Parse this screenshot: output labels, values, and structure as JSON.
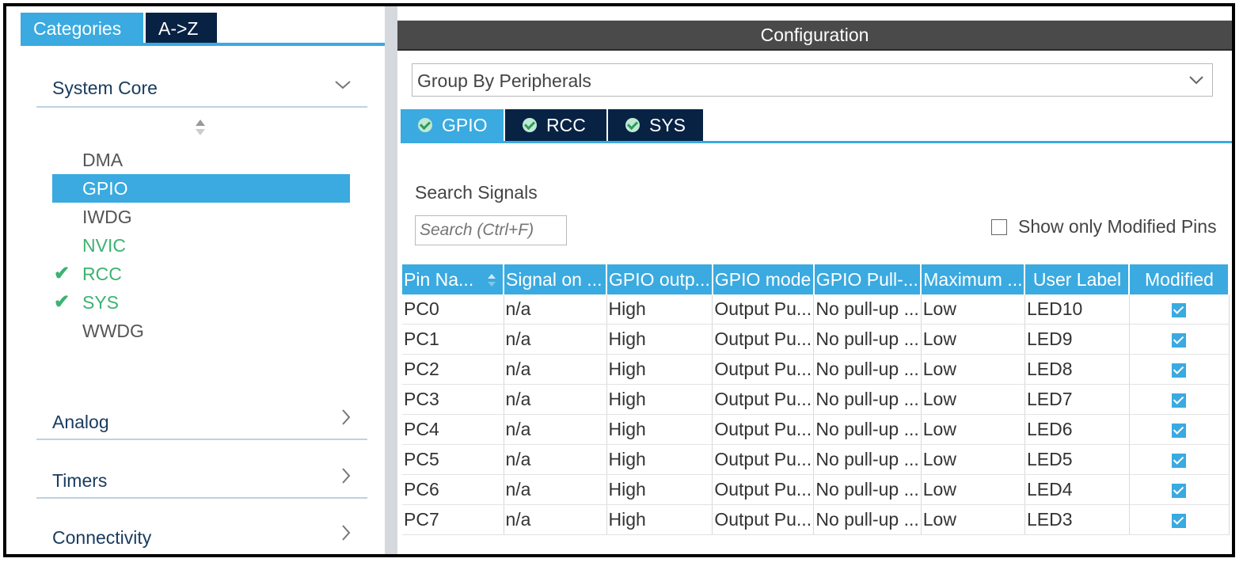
{
  "left_panel": {
    "tabs": [
      {
        "label": "Categories",
        "active": true
      },
      {
        "label": "A->Z",
        "active": false
      }
    ],
    "categories": {
      "system_core": "System Core",
      "analog": "Analog",
      "timers": "Timers",
      "connectivity": "Connectivity"
    },
    "items": [
      {
        "label": "DMA",
        "state": "normal"
      },
      {
        "label": "GPIO",
        "state": "selected"
      },
      {
        "label": "IWDG",
        "state": "normal"
      },
      {
        "label": "NVIC",
        "state": "green"
      },
      {
        "label": "RCC",
        "state": "checked"
      },
      {
        "label": "SYS",
        "state": "checked"
      },
      {
        "label": "WWDG",
        "state": "normal"
      }
    ]
  },
  "config": {
    "title": "Configuration",
    "group_by": "Group By Peripherals",
    "tabs": [
      {
        "label": "GPIO",
        "active": true
      },
      {
        "label": "RCC",
        "active": false
      },
      {
        "label": "SYS",
        "active": false
      }
    ],
    "search_label": "Search Signals",
    "search_placeholder": "Search (Ctrl+F)",
    "show_modified_label": "Show only Modified Pins",
    "show_modified_checked": false
  },
  "table": {
    "columns": [
      "Pin Na...",
      "Signal on ...",
      "GPIO outp...",
      "GPIO mode",
      "GPIO Pull-...",
      "Maximum ...",
      "User Label",
      "Modified"
    ],
    "rows": [
      [
        "PC0",
        "n/a",
        "High",
        "Output Pu...",
        "No pull-up ...",
        "Low",
        "LED10",
        true
      ],
      [
        "PC1",
        "n/a",
        "High",
        "Output Pu...",
        "No pull-up ...",
        "Low",
        "LED9",
        true
      ],
      [
        "PC2",
        "n/a",
        "High",
        "Output Pu...",
        "No pull-up ...",
        "Low",
        "LED8",
        true
      ],
      [
        "PC3",
        "n/a",
        "High",
        "Output Pu...",
        "No pull-up ...",
        "Low",
        "LED7",
        true
      ],
      [
        "PC4",
        "n/a",
        "High",
        "Output Pu...",
        "No pull-up ...",
        "Low",
        "LED6",
        true
      ],
      [
        "PC5",
        "n/a",
        "High",
        "Output Pu...",
        "No pull-up ...",
        "Low",
        "LED5",
        true
      ],
      [
        "PC6",
        "n/a",
        "High",
        "Output Pu...",
        "No pull-up ...",
        "Low",
        "LED4",
        true
      ],
      [
        "PC7",
        "n/a",
        "High",
        "Output Pu...",
        "No pull-up ...",
        "Low",
        "LED3",
        true
      ]
    ]
  },
  "colors": {
    "accent": "#3aaae0",
    "dark_tab": "#082244",
    "header_bar": "#4a4a4a",
    "ok_green": "#3cb371"
  },
  "icons": {
    "category_expand": "chevron-down-icon",
    "category_collapsed": "chevron-right-icon",
    "tab_status": "check-circle-icon",
    "modified": "checkbox-checked-icon"
  }
}
